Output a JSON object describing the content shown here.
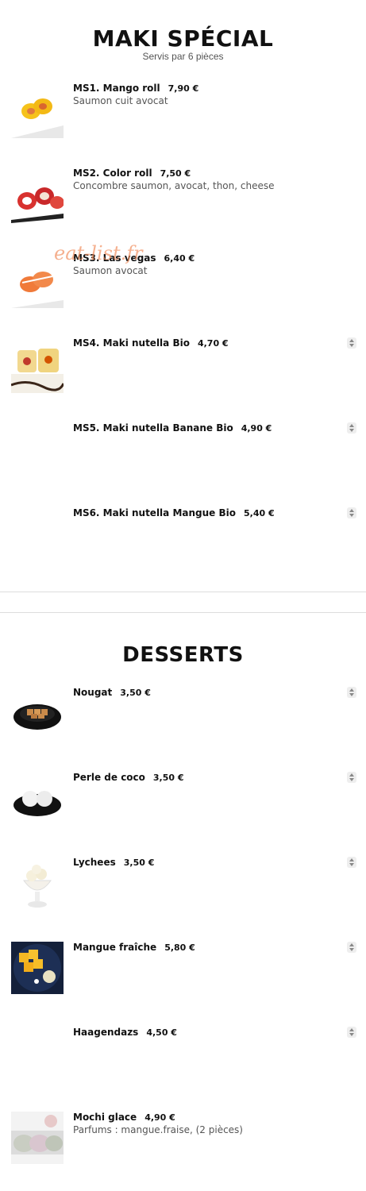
{
  "maki": {
    "title": "MAKI SPÉCIAL",
    "subtitle": "Servis par 6 pièces",
    "items": [
      {
        "name": "MS1. Mango roll",
        "price": "7,90 €",
        "desc": "Saumon cuit avocat",
        "icon": "mango-roll-photo"
      },
      {
        "name": "MS2. Color roll",
        "price": "7,50 €",
        "desc": "Concombre saumon, avocat, thon, cheese",
        "icon": "color-roll-photo"
      },
      {
        "name": "MS3. Las vegas",
        "price": "6,40 €",
        "desc": "Saumon avocat",
        "icon": "las-vegas-photo"
      },
      {
        "name": "MS4. Maki nutella Bio",
        "price": "4,70 €",
        "desc": "",
        "icon": "maki-nutella-photo"
      },
      {
        "name": "MS5. Maki nutella Banane Bio",
        "price": "4,90 €",
        "desc": ""
      },
      {
        "name": "MS6. Maki nutella Mangue Bio",
        "price": "5,40 €",
        "desc": ""
      }
    ]
  },
  "watermark": "eat-list.fr",
  "desserts": {
    "title": "DESSERTS",
    "items": [
      {
        "name": "Nougat",
        "price": "3,50 €",
        "desc": "",
        "icon": "nougat-photo"
      },
      {
        "name": "Perle de coco",
        "price": "3,50 €",
        "desc": "",
        "icon": "perle-de-coco-photo"
      },
      {
        "name": "Lychees",
        "price": "3,50 €",
        "desc": "",
        "icon": "lychees-photo"
      },
      {
        "name": "Mangue fraîche",
        "price": "5,80 €",
        "desc": "",
        "icon": "mangue-photo"
      },
      {
        "name": "Haagendazs",
        "price": "4,50 €",
        "desc": ""
      },
      {
        "name": "Mochi glace",
        "price": "4,90 €",
        "desc": "Parfums : mangue.fraise, (2 pièces)",
        "icon": "mochi-photo"
      }
    ]
  }
}
